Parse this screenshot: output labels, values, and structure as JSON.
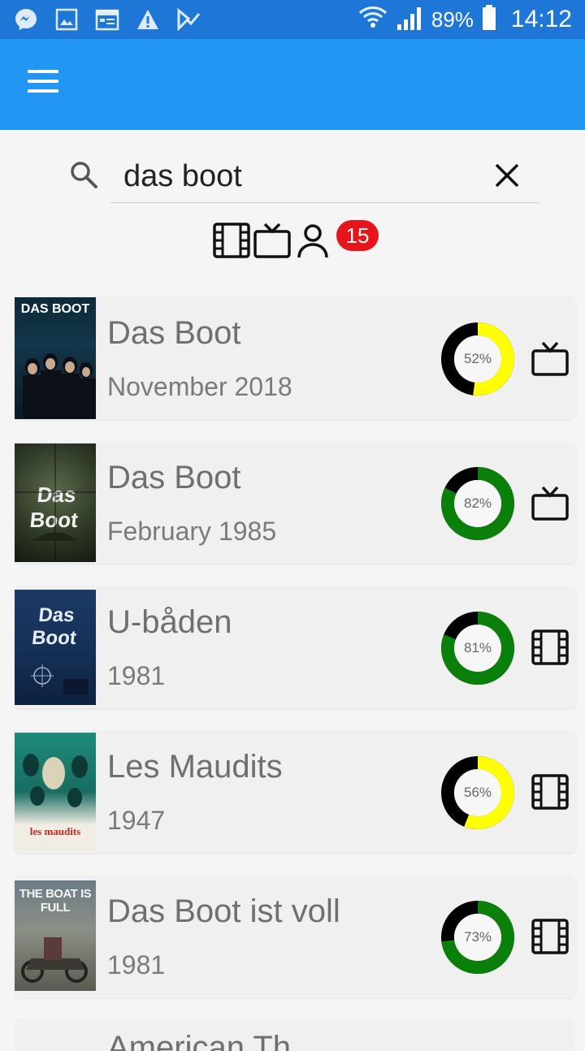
{
  "status_bar": {
    "icons": [
      "messenger-icon",
      "image-icon",
      "calendar-icon",
      "warning-icon",
      "delivery-icon"
    ],
    "battery": "89%",
    "time": "14:12"
  },
  "search": {
    "query": "das boot",
    "placeholder": ""
  },
  "filters": {
    "badge_count": "15"
  },
  "colors": {
    "status_bar": "#1e77d6",
    "app_bar": "#2196f3",
    "rating_green": "#0a7f0a",
    "rating_yellow": "#ffff00",
    "badge": "#e8141b"
  },
  "results": [
    {
      "title": "Das Boot",
      "date": "November 2018",
      "rating": 52,
      "rating_label": "52%",
      "type": "tv-icon",
      "poster_text": "DAS BOOT"
    },
    {
      "title": "Das Boot",
      "date": "February 1985",
      "rating": 82,
      "rating_label": "82%",
      "type": "tv-icon",
      "poster_text": "Das Boot"
    },
    {
      "title": "U-båden",
      "date": "1981",
      "rating": 81,
      "rating_label": "81%",
      "type": "film-icon",
      "poster_text": "Das Boot"
    },
    {
      "title": "Les Maudits",
      "date": "1947",
      "rating": 56,
      "rating_label": "56%",
      "type": "film-icon",
      "poster_text": "les maudits"
    },
    {
      "title": "Das Boot ist voll",
      "date": "1981",
      "rating": 73,
      "rating_label": "73%",
      "type": "film-icon",
      "poster_text": "THE BOAT IS FULL"
    }
  ],
  "partial_result": {
    "title": "American Th"
  }
}
